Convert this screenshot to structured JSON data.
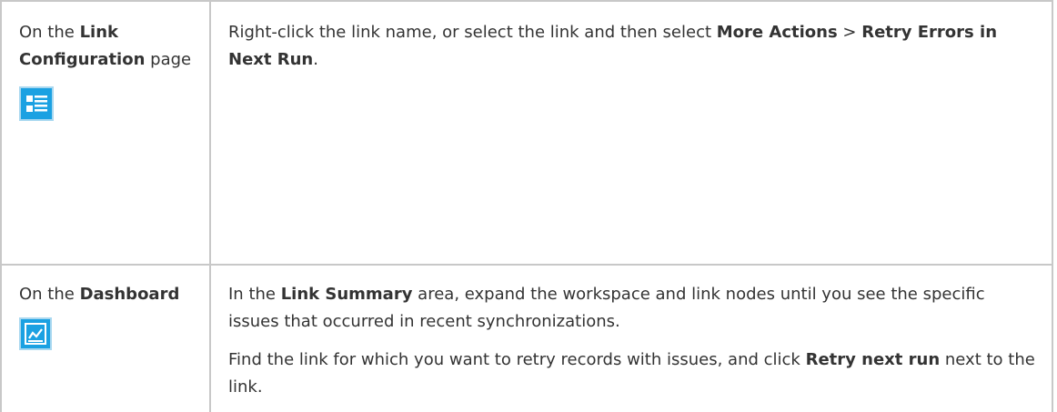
{
  "row1": {
    "col1_prefix": "On the ",
    "col1_bold": "Link Configuration",
    "col1_suffix": "page",
    "icon": "list-view-icon",
    "col2_text1": "Right-click the link name, or select the link and then select ",
    "col2_bold1": "More Actions",
    "col2_sep": " > ",
    "col2_bold2": "Retry Errors in Next Run",
    "col2_end": "."
  },
  "row2": {
    "col1_prefix": "On the ",
    "col1_bold": "Dashboard",
    "icon": "dashboard-chart-icon",
    "p1_text1": "In the ",
    "p1_bold": "Link Summary",
    "p1_text2": " area, expand the workspace and link nodes until you see the specific issues that occurred in recent synchronizations.",
    "p2_text1": "Find the link for which you want to retry records with issues, and click ",
    "p2_bold": "Retry next run",
    "p2_text2": " next to the link."
  },
  "colors": {
    "border": "#c8c8c8",
    "icon_bg": "#1ba1e2",
    "text": "#333333"
  }
}
